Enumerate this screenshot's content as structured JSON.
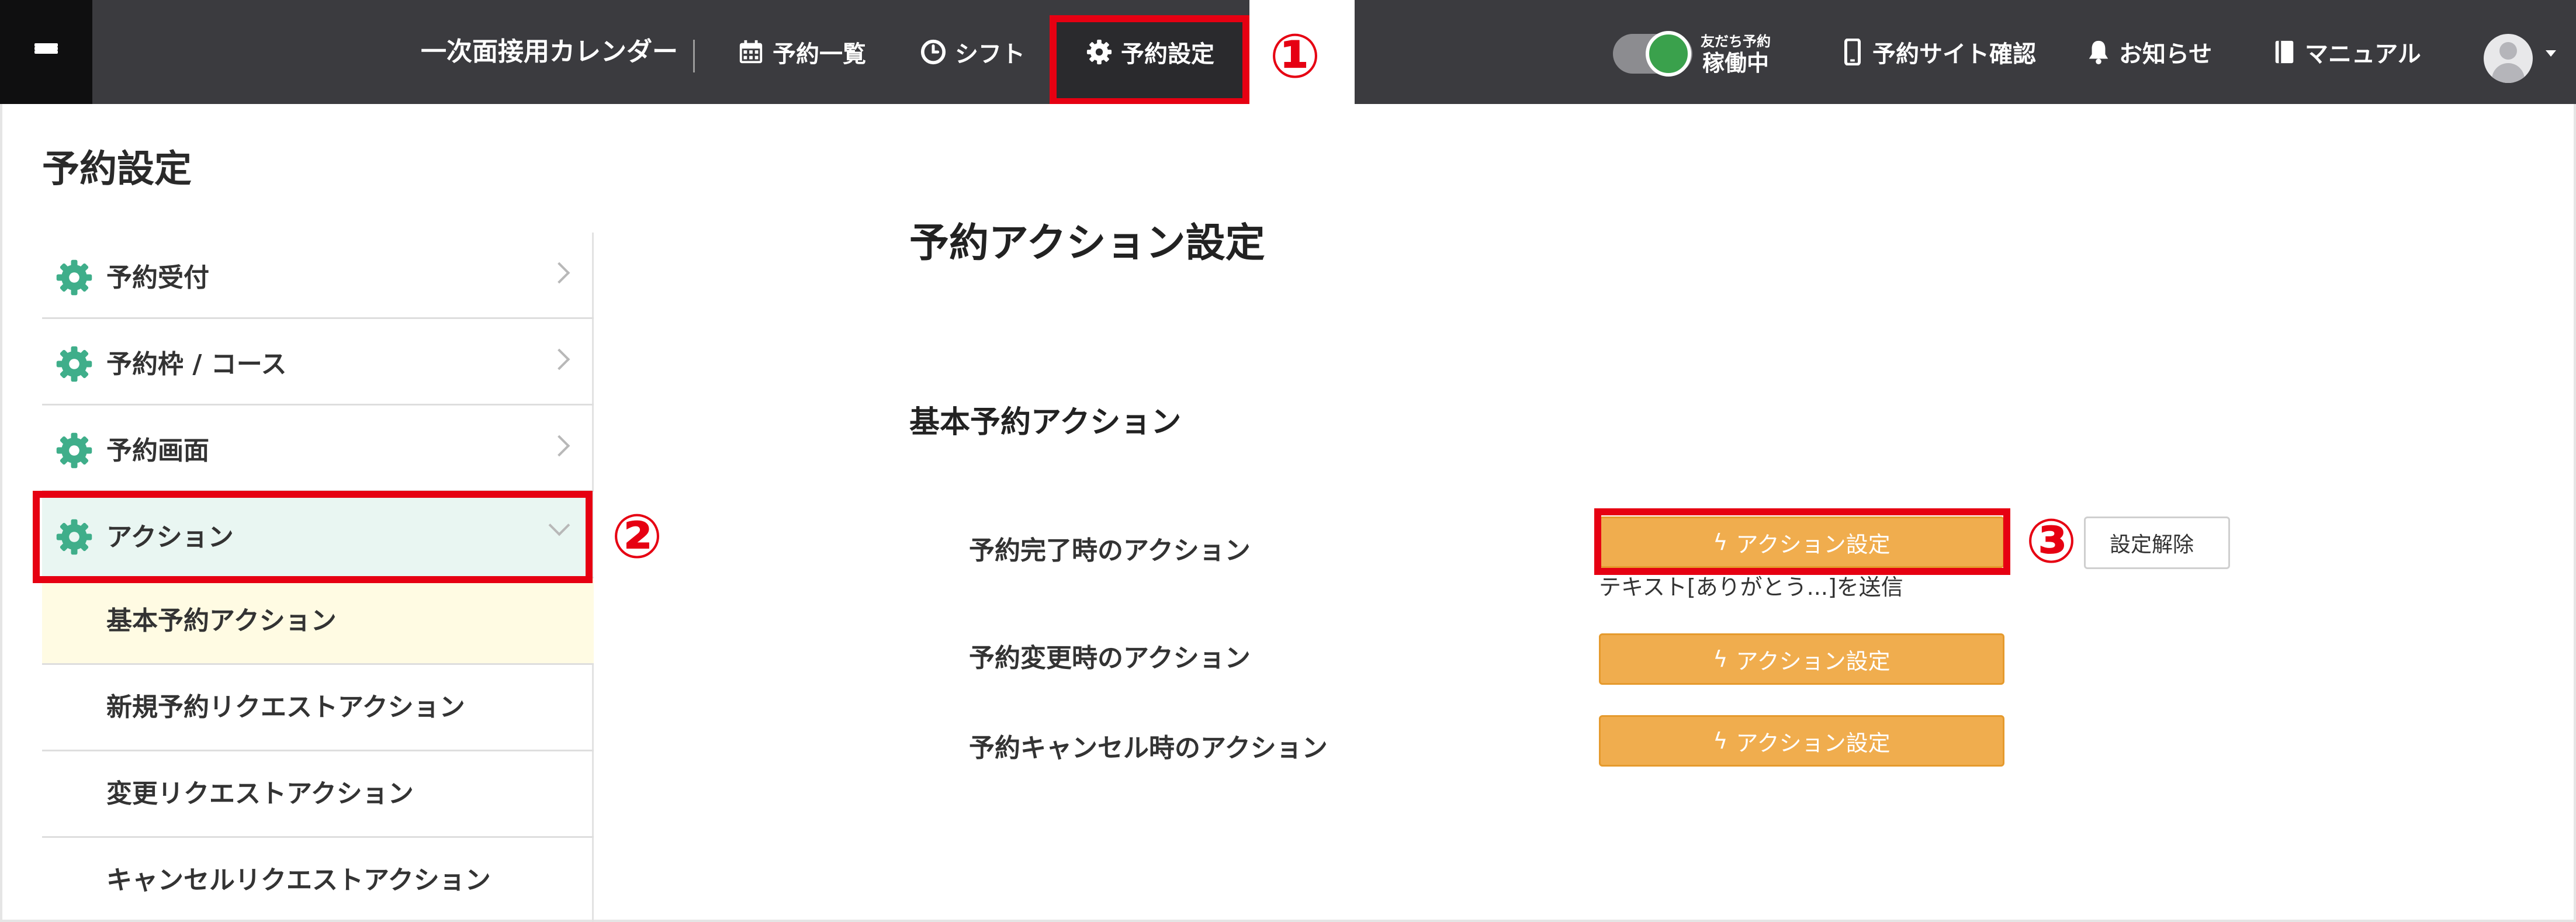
{
  "header": {
    "app_title": "一次面接用カレンダー",
    "nav": [
      {
        "label": "予約一覧",
        "icon": "calendar-icon"
      },
      {
        "label": "シフト",
        "icon": "clock-icon"
      },
      {
        "label": "予約設定",
        "icon": "gear-icon"
      }
    ],
    "toggle": {
      "small_label": "友だち予約",
      "status": "稼働中",
      "on": true
    },
    "right_nav": [
      {
        "label": "予約サイト確認",
        "icon": "smartphone-icon"
      },
      {
        "label": "お知らせ",
        "icon": "bell-icon"
      },
      {
        "label": "マニュアル",
        "icon": "book-icon"
      }
    ]
  },
  "annotations": {
    "one": "①",
    "two": "②",
    "three": "③"
  },
  "page": {
    "title": "予約設定"
  },
  "sidebar": {
    "items": [
      {
        "label": "予約受付"
      },
      {
        "label": "予約枠 / コース"
      },
      {
        "label": "予約画面"
      },
      {
        "label": "アクション"
      }
    ],
    "sub_items": [
      {
        "label": "基本予約アクション"
      },
      {
        "label": "新規予約リクエストアクション"
      },
      {
        "label": "変更リクエストアクション"
      },
      {
        "label": "キャンセルリクエストアクション"
      }
    ]
  },
  "main": {
    "title": "予約アクション設定",
    "section_title": "基本予約アクション",
    "rows": [
      {
        "label": "予約完了時のアクション",
        "button": "アクション設定",
        "release": "設定解除",
        "note": "テキスト[ありがとう...]を送信"
      },
      {
        "label": "予約変更時のアクション",
        "button": "アクション設定"
      },
      {
        "label": "予約キャンセル時のアクション",
        "button": "アクション設定"
      }
    ]
  },
  "colors": {
    "accent_orange": "#f0ad4e",
    "highlight_red": "#e60012",
    "topbar": "#3b3b3f",
    "gear_green": "#3fae8a",
    "toggle_green": "#3aa14c"
  }
}
